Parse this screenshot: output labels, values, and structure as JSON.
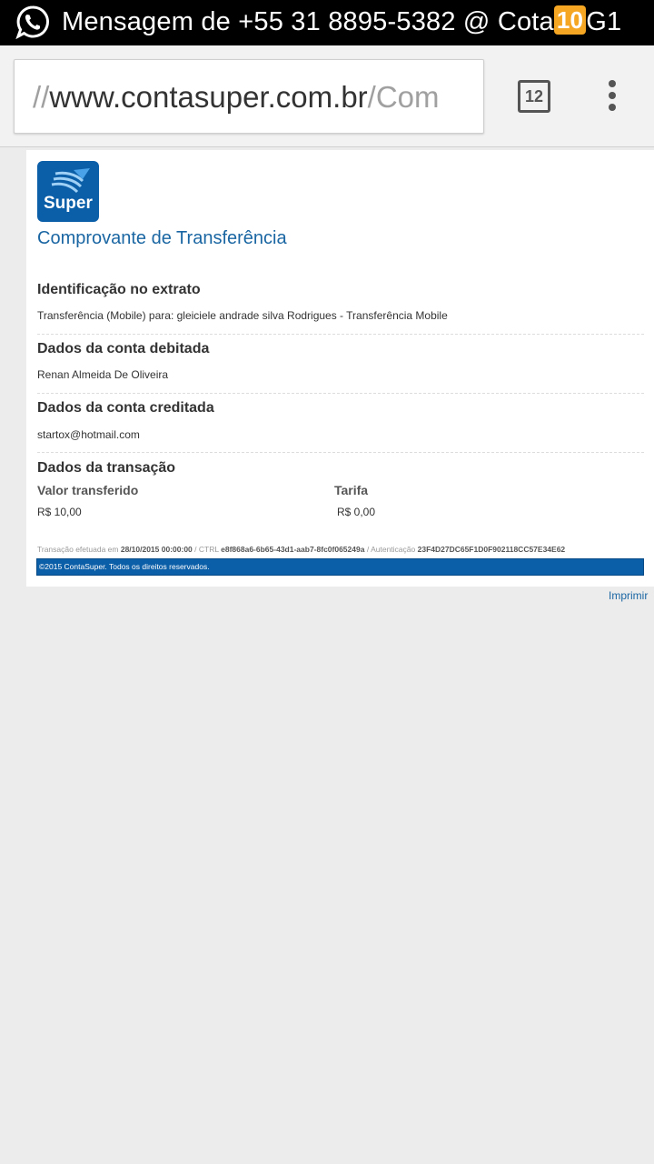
{
  "notification": {
    "text_before": "Mensagem de +55 31 8895-5382 @ Cota",
    "badge": "10",
    "text_after": "G1"
  },
  "browser": {
    "url_scheme_part": "//",
    "url_domain": "www.contasuper.com.br",
    "url_path": "/Com",
    "tab_count": "12"
  },
  "page": {
    "logo_text": "Super",
    "title": "Comprovante de Transferência",
    "sections": {
      "identificacao": {
        "heading": "Identificação no extrato",
        "text": "Transferência (Mobile) para: gleiciele andrade silva Rodrigues - Transferência Mobile"
      },
      "debitada": {
        "heading": "Dados da conta debitada",
        "text": "Renan Almeida De Oliveira"
      },
      "creditada": {
        "heading": "Dados da conta creditada",
        "text": "startox@hotmail.com"
      },
      "transacao": {
        "heading": "Dados da transação",
        "valor_label": "Valor transferido",
        "valor": "R$ 10,00",
        "tarifa_label": "Tarifa",
        "tarifa": "R$ 0,00"
      }
    },
    "footer": {
      "label_date": "Transação efetuada em",
      "date": "28/10/2015 00:00:00",
      "label_ctrl": "/ CTRL",
      "ctrl": "e8f868a6-6b65-43d1-aab7-8fc0f065249a",
      "label_auth": "/ Autenticação",
      "auth": "23F4D27DC65F1D0F902118CC57E34E62",
      "copyright": "©2015 ContaSuper. Todos os direitos reservados."
    },
    "print_link": "Imprimir"
  }
}
